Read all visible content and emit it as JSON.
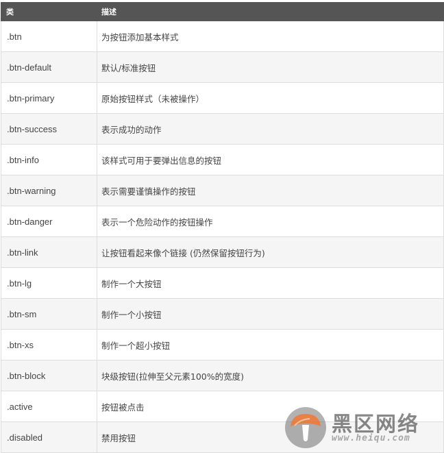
{
  "table": {
    "headers": [
      "类",
      "描述"
    ],
    "rows": [
      {
        "cls": ".btn",
        "desc": "为按钮添加基本样式"
      },
      {
        "cls": ".btn-default",
        "desc": "默认/标准按钮"
      },
      {
        "cls": ".btn-primary",
        "desc": "原始按钮样式（未被操作）"
      },
      {
        "cls": ".btn-success",
        "desc": "表示成功的动作"
      },
      {
        "cls": ".btn-info",
        "desc": "该样式可用于要弹出信息的按钮"
      },
      {
        "cls": ".btn-warning",
        "desc": "表示需要谨慎操作的按钮"
      },
      {
        "cls": ".btn-danger",
        "desc": "表示一个危险动作的按钮操作"
      },
      {
        "cls": ".btn-link",
        "desc": "让按钮看起来像个链接 (仍然保留按钮行为)"
      },
      {
        "cls": ".btn-lg",
        "desc": "制作一个大按钮"
      },
      {
        "cls": ".btn-sm",
        "desc": "制作一个小按钮"
      },
      {
        "cls": ".btn-xs",
        "desc": "制作一个超小按钮"
      },
      {
        "cls": ".btn-block",
        "desc": "块级按钮(拉伸至父元素100%的宽度)"
      },
      {
        "cls": ".active",
        "desc": "按钮被点击"
      },
      {
        "cls": ".disabled",
        "desc": "禁用按钮"
      }
    ]
  },
  "watermark": {
    "title": "黑区网络",
    "url": "www.heiqu.com"
  },
  "colors": {
    "header_bg": "#555555",
    "header_text": "#ffffff",
    "row_alt_bg": "#f5f5f5",
    "border": "#dddddd",
    "logo_orange": "#e36c2a"
  }
}
